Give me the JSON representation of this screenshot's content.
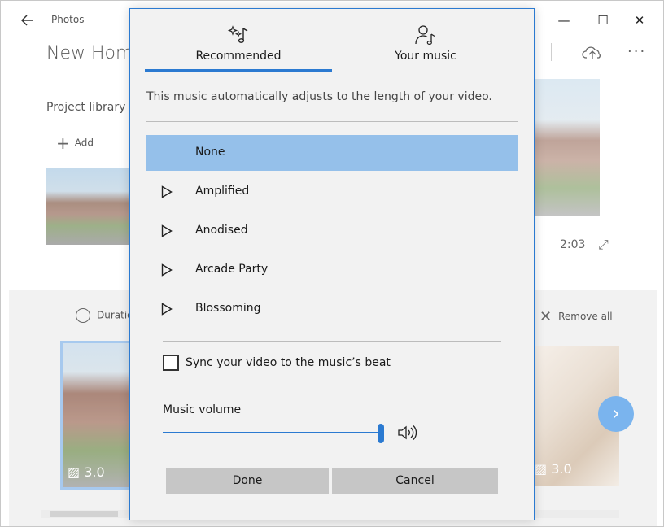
{
  "app": {
    "name": "Photos",
    "project_title": "New Home",
    "library_label": "Project library",
    "add_label": "Add",
    "preview_time": "2:03",
    "duration_label": "Duration",
    "remove_all_label": "Remove all",
    "card1_duration": "3.0",
    "card2_duration": "3.0"
  },
  "window_controls": {
    "minimize": "—",
    "maximize": "☐",
    "close": "✕"
  },
  "dialog": {
    "tabs": [
      {
        "label": "Recommended",
        "icon": "sparkle-note-icon",
        "active": true
      },
      {
        "label": "Your music",
        "icon": "person-note-icon",
        "active": false
      }
    ],
    "description": "This music automatically adjusts to the length of your video.",
    "tracks": [
      {
        "name": "None",
        "selected": true
      },
      {
        "name": "Amplified",
        "selected": false
      },
      {
        "name": "Anodised",
        "selected": false
      },
      {
        "name": "Arcade Party",
        "selected": false
      },
      {
        "name": "Blossoming",
        "selected": false
      }
    ],
    "sync_label": "Sync your video to the music’s beat",
    "sync_checked": false,
    "volume_label": "Music volume",
    "volume_level": 1.0,
    "done_label": "Done",
    "cancel_label": "Cancel"
  },
  "colors": {
    "accent": "#2b7ad1",
    "selected_row": "#95c0ea",
    "button_bg": "#c6c6c6",
    "dialog_bg": "#f2f2f2"
  }
}
